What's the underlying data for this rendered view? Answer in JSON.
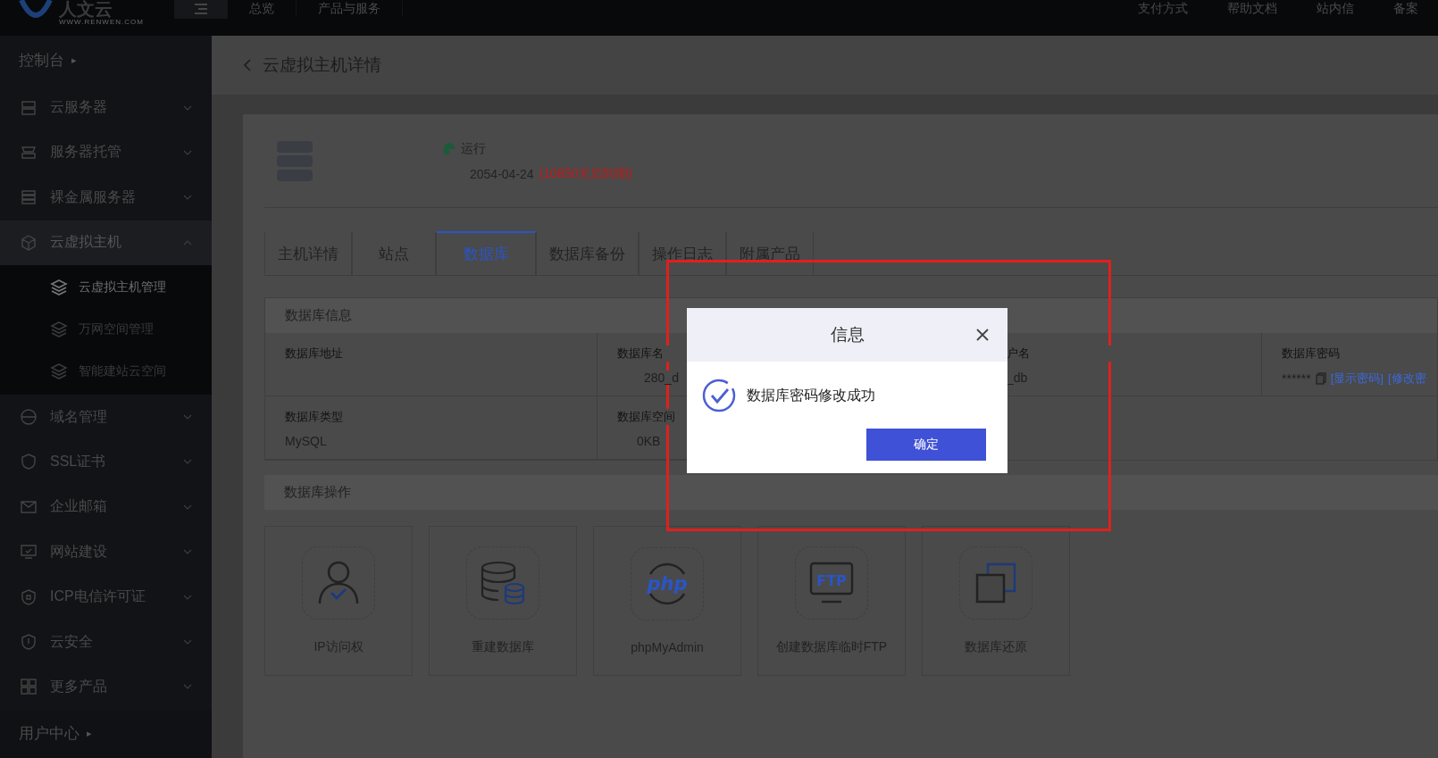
{
  "topbar": {
    "logo": {
      "name": "人文云",
      "url": "WWW.RENWEN.COM"
    },
    "nav": [
      "总览",
      "产品与服务"
    ],
    "links": [
      "支付方式",
      "帮助文档",
      "站内信",
      "备案"
    ]
  },
  "sidebar": {
    "console": "控制台",
    "console_arrow": "▸",
    "items": [
      {
        "label": "云服务器",
        "expanded": false
      },
      {
        "label": "服务器托管",
        "expanded": false
      },
      {
        "label": "裸金属服务器",
        "expanded": false
      },
      {
        "label": "云虚拟主机",
        "expanded": true,
        "children": [
          {
            "label": "云虚拟主机管理",
            "selected": true
          },
          {
            "label": "万网空间管理",
            "selected": false
          },
          {
            "label": "智能建站云空间",
            "selected": false
          }
        ]
      },
      {
        "label": "域名管理",
        "expanded": false
      },
      {
        "label": "SSL证书",
        "expanded": false
      },
      {
        "label": "企业邮箱",
        "expanded": false
      },
      {
        "label": "网站建设",
        "expanded": false
      },
      {
        "label": "ICP电信许可证",
        "expanded": false
      },
      {
        "label": "云安全",
        "expanded": false
      },
      {
        "label": "更多产品",
        "expanded": false
      }
    ],
    "user_center": "用户中心",
    "user_center_arrow": "▸"
  },
  "page": {
    "title": "云虚拟主机详情"
  },
  "host": {
    "status": "运行",
    "expiry": "2054-04-24",
    "remaining": "(10850天后到期)"
  },
  "tabs": [
    {
      "label": "主机详情",
      "selected": false
    },
    {
      "label": "站点",
      "selected": false
    },
    {
      "label": "数据库",
      "selected": true
    },
    {
      "label": "数据库备份",
      "selected": false
    },
    {
      "label": "操作日志",
      "selected": false
    },
    {
      "label": "附属产品",
      "selected": false
    }
  ],
  "db_info": {
    "title": "数据库信息",
    "fields": [
      {
        "label": "数据库地址"
      },
      {
        "label": "数据库名",
        "value": "280_d"
      },
      {
        "label": "户名",
        "value": "_db"
      },
      {
        "label": "数据库密码",
        "value": "******",
        "links": [
          "[显示密码]",
          "[修改密"
        ]
      },
      {
        "label": "数据库类型",
        "value": "MySQL"
      },
      {
        "label": "数据库空间",
        "value": "0KB"
      }
    ]
  },
  "db_ops": {
    "title": "数据库操作",
    "items": [
      {
        "label": "IP访问权"
      },
      {
        "label": "重建数据库"
      },
      {
        "label": "phpMyAdmin",
        "icon_text": "php"
      },
      {
        "label": "创建数据库临时FTP",
        "icon_text": "FTP"
      },
      {
        "label": "数据库还原"
      }
    ]
  },
  "dialog": {
    "title": "信息",
    "message": "数据库密码修改成功",
    "button": "确定"
  }
}
